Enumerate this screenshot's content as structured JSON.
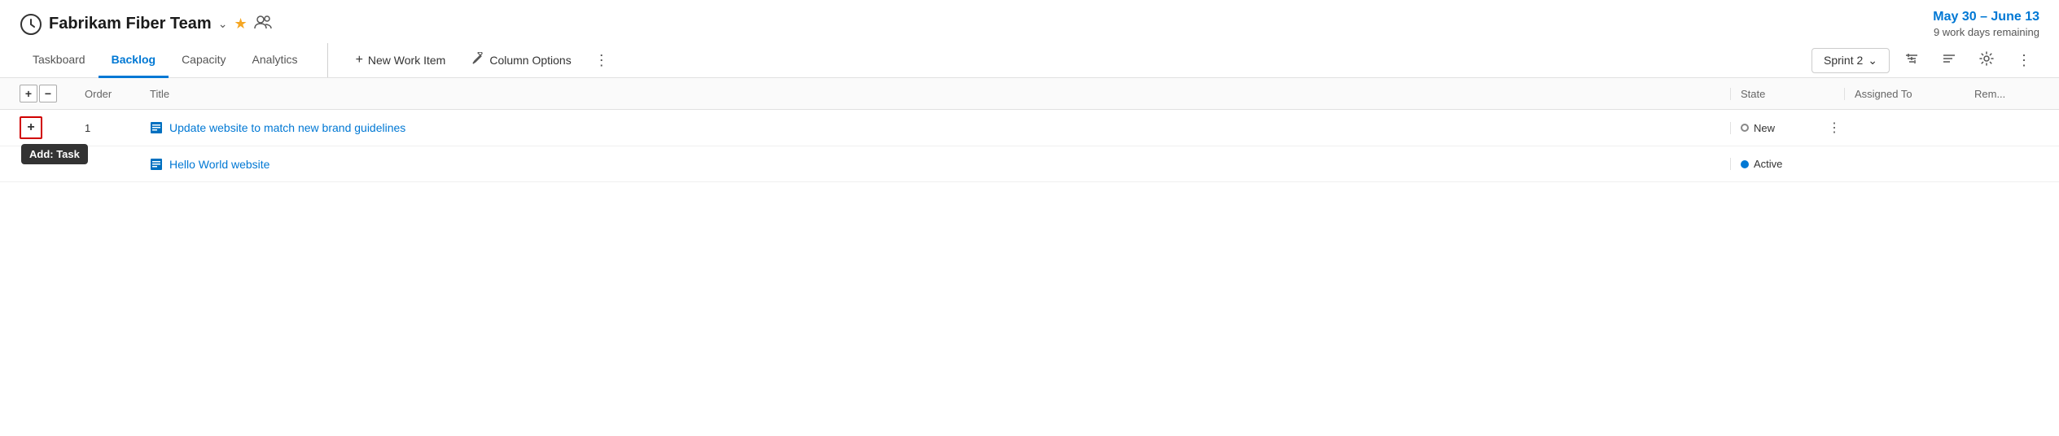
{
  "header": {
    "team_icon": "⏰",
    "team_name": "Fabrikam Fiber Team",
    "chevron": "∨",
    "star": "★",
    "members_icon": "👥",
    "sprint_dates": "May 30 – June 13",
    "sprint_days": "9 work days remaining"
  },
  "nav": {
    "tabs": [
      {
        "label": "Taskboard",
        "active": false
      },
      {
        "label": "Backlog",
        "active": true
      },
      {
        "label": "Capacity",
        "active": false
      },
      {
        "label": "Analytics",
        "active": false
      }
    ],
    "actions": [
      {
        "id": "new-work-item",
        "icon": "+",
        "label": "New Work Item"
      },
      {
        "id": "column-options",
        "icon": "🔧",
        "label": "Column Options"
      }
    ],
    "more_label": "⋮"
  },
  "toolbar": {
    "sprint_label": "Sprint 2",
    "filter_icon": "filter",
    "sort_icon": "sort",
    "settings_icon": "settings",
    "more_icon": "⋮"
  },
  "table": {
    "columns": [
      "",
      "Order",
      "Title",
      "State",
      "",
      "Assigned To",
      "Rem..."
    ],
    "rows": [
      {
        "order": "1",
        "title": "Update website to match new brand guidelines",
        "state": "New",
        "state_type": "new",
        "assigned_to": "",
        "rem": ""
      },
      {
        "order": "",
        "title": "Hello World website",
        "state": "Active",
        "state_type": "active",
        "assigned_to": "",
        "rem": ""
      }
    ],
    "tooltip": "Add: Task"
  }
}
